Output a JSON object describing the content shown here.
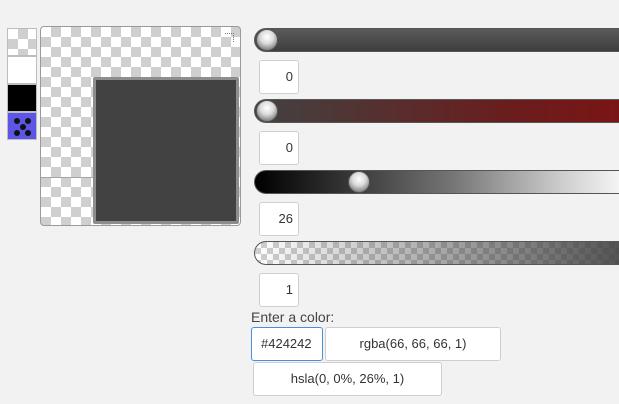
{
  "swatches": [
    {
      "name": "transparent"
    },
    {
      "name": "white",
      "color": "#ffffff"
    },
    {
      "name": "black",
      "color": "#000000"
    },
    {
      "name": "custom",
      "color": "#5b55e8"
    }
  ],
  "preview": {
    "color": "#424242"
  },
  "sliders": [
    {
      "name": "hue",
      "value": "0",
      "level": 0
    },
    {
      "name": "saturation",
      "value": "0",
      "level": 0
    },
    {
      "name": "lightness",
      "value": "26",
      "level": 0.26
    },
    {
      "name": "alpha",
      "value": "1",
      "level": 1
    }
  ],
  "input": {
    "label": "Enter a color:",
    "hex": "#424242",
    "rgba": "rgba(66, 66, 66, 1)",
    "hsla": "hsla(0, 0%, 26%, 1)"
  }
}
